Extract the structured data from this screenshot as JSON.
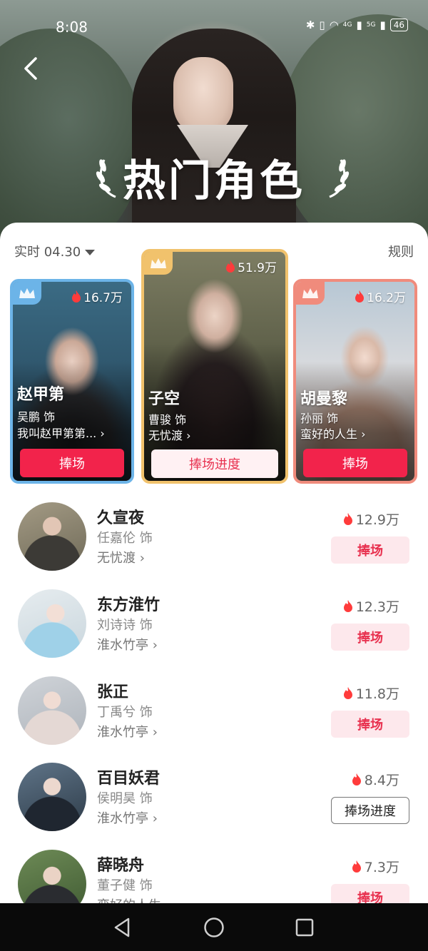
{
  "status_bar": {
    "time": "8:08",
    "signal_1": "4G",
    "signal_2": "5G",
    "battery": "46"
  },
  "header": {
    "title": "热门角色"
  },
  "filter": {
    "date_label": "实时 04.30",
    "rules_label": "规则"
  },
  "top_cards": [
    {
      "name": "赵甲第",
      "actor": "吴鹏 饰",
      "show": "我叫赵甲第第...",
      "heat": "16.7万",
      "button": "捧场"
    },
    {
      "name": "子空",
      "actor": "曹骏 饰",
      "show": "无忧渡",
      "heat": "51.9万",
      "button": "捧场进度"
    },
    {
      "name": "胡曼黎",
      "actor": "孙丽 饰",
      "show": "蛮好的人生",
      "heat": "16.2万",
      "button": "捧场"
    }
  ],
  "list": [
    {
      "name": "久宣夜",
      "actor": "任嘉伦 饰",
      "show": "无忧渡",
      "heat": "12.9万",
      "button": "捧场"
    },
    {
      "name": "东方淮竹",
      "actor": "刘诗诗 饰",
      "show": "淮水竹亭",
      "heat": "12.3万",
      "button": "捧场"
    },
    {
      "name": "张正",
      "actor": "丁禹兮 饰",
      "show": "淮水竹亭",
      "heat": "11.8万",
      "button": "捧场"
    },
    {
      "name": "百目妖君",
      "actor": "侯明昊 饰",
      "show": "淮水竹亭",
      "heat": "8.4万",
      "button": "捧场进度"
    },
    {
      "name": "薛晓舟",
      "actor": "董子健 饰",
      "show": "蛮好的人生",
      "heat": "7.3万",
      "button": "捧场"
    }
  ],
  "colors": {
    "accent_red": "#f2234b",
    "pink_button_bg": "#fde8ec",
    "crown_blue": "#6cb4e8",
    "crown_gold": "#f1c26c",
    "crown_coral": "#f08b7c"
  },
  "icons": [
    "back-arrow-icon",
    "laurel-icon",
    "crown-icon",
    "flame-icon",
    "chevron-right-icon",
    "nav-back-icon",
    "nav-home-icon",
    "nav-recents-icon"
  ]
}
